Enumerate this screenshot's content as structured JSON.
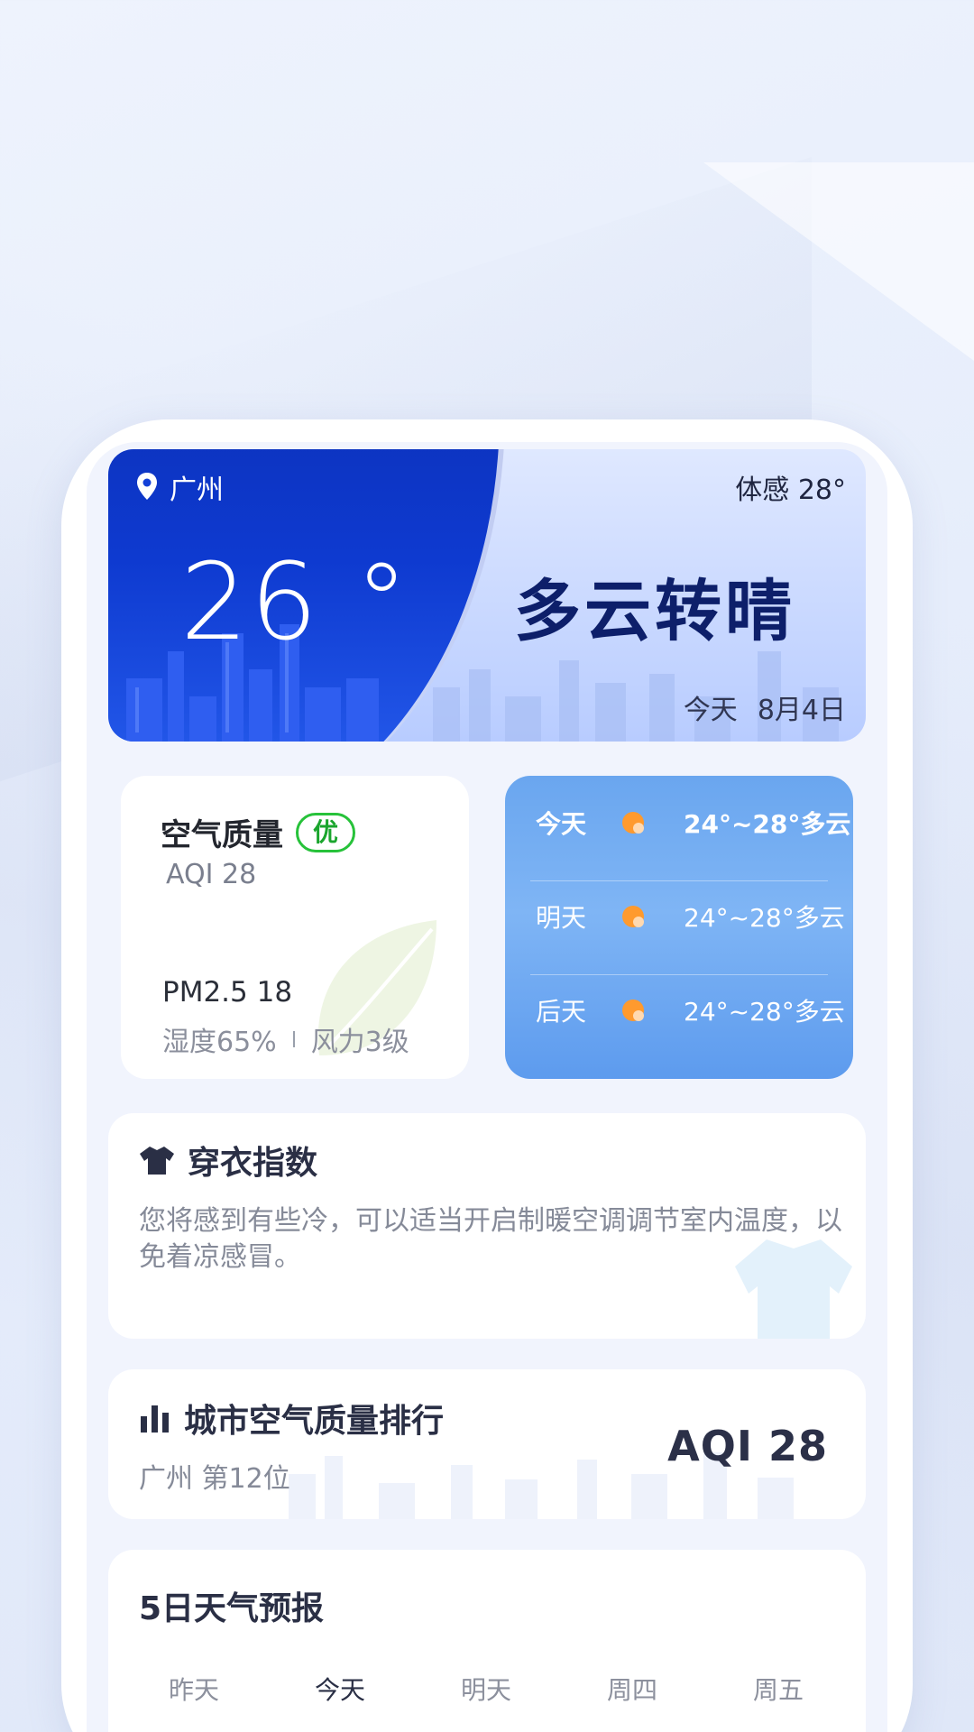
{
  "hero": {
    "city": "广州",
    "temperature": "26 °",
    "feels_like": "体感 28°",
    "condition": "多云转晴",
    "date_day": "今天",
    "date": "8月4日"
  },
  "air_quality": {
    "title": "空气质量",
    "level": "优",
    "aqi": "AQI  28",
    "pm25": "PM2.5 18",
    "humidity": "湿度65%",
    "wind": "风力3级"
  },
  "forecast": [
    {
      "day": "今天",
      "range": "24°~28°多云",
      "icon": "partly-cloudy-icon"
    },
    {
      "day": "明天",
      "range": "24°~28°多云",
      "icon": "partly-cloudy-icon"
    },
    {
      "day": "后天",
      "range": "24°~28°多云",
      "icon": "partly-cloudy-icon"
    }
  ],
  "clothing": {
    "title": "穿衣指数",
    "text": "您将感到有些冷，可以适当开启制暖空调调节室内温度，以免着凉感冒。"
  },
  "ranking": {
    "title": "城市空气质量排行",
    "subtitle": "广州 第12位",
    "aqi": "AQI  28"
  },
  "five_day": {
    "title": "5日天气预报",
    "tabs": [
      "昨天",
      "今天",
      "明天",
      "周四",
      "周五"
    ]
  },
  "colors": {
    "hero_blue": "#0e3ad0",
    "badge_green": "#27c23a",
    "forecast_blue": "#6aa6ef"
  }
}
